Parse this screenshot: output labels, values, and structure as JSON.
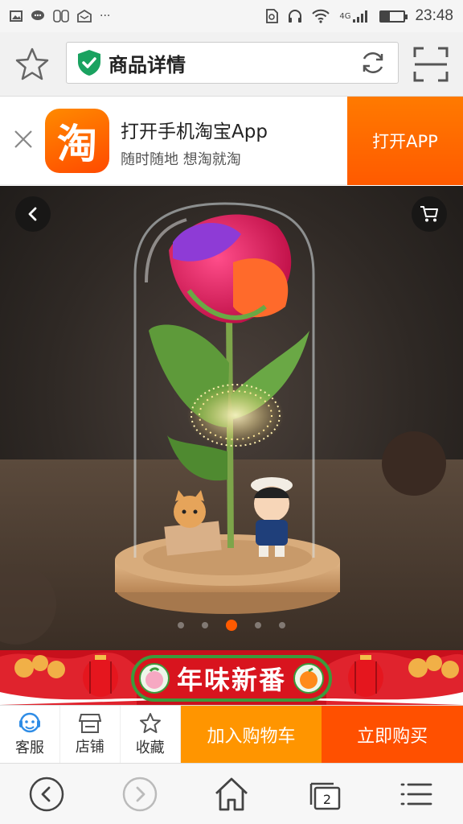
{
  "status_bar": {
    "time": "23:48",
    "network": "4G"
  },
  "browser": {
    "page_title": "商品详情"
  },
  "app_banner": {
    "logo_char": "淘",
    "title": "打开手机淘宝App",
    "subtitle": "随时随地 想淘就淘",
    "open_label": "打开APP"
  },
  "gallery": {
    "total_images": 5,
    "active_index": 2
  },
  "festive_banner": {
    "text": "年味新番"
  },
  "actions": {
    "service_label": "客服",
    "shop_label": "店铺",
    "favorite_label": "收藏",
    "add_cart_label": "加入购物车",
    "buy_now_label": "立即购买"
  },
  "bottom_nav": {
    "tab_count": "2"
  },
  "colors": {
    "accent": "#ff5000",
    "add_cart": "#ff9500",
    "festive_red": "#c8101c",
    "secure_green": "#1aa260"
  }
}
